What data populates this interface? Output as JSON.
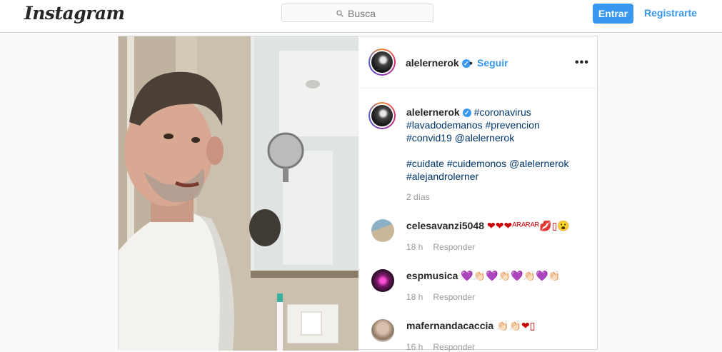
{
  "header": {
    "logo": "Instagram",
    "search_placeholder": "Busca",
    "login_label": "Entrar",
    "register_label": "Registrarte"
  },
  "post": {
    "author": "alelernerok",
    "separator": "•",
    "follow_label": "Seguir",
    "more_label": "•••",
    "caption": {
      "username": "alelernerok",
      "line1": "#coronavirus",
      "line2": "#lavadodemanos #prevencion",
      "line3": "#convid19 @alelernerok",
      "line4": "#cuidate #cuidemonos @alelernerok",
      "line5": "#alejandrolerner"
    },
    "age": "2 días"
  },
  "comments": [
    {
      "username": "celesavanzi5048",
      "text": "❤❤❤ᴬᴿᴬᴿᴬᴿ💋▯😮",
      "time": "18 h",
      "reply_label": "Responder"
    },
    {
      "username": "espmusica",
      "text": "💜👏🏻💜👏🏻💜👏🏻💜👏🏻",
      "time": "18 h",
      "reply_label": "Responder"
    },
    {
      "username": "mafernandacaccia",
      "text": "👏🏻👏🏻❤▯",
      "time": "16 h",
      "reply_label": "Responder"
    }
  ],
  "colors": {
    "accent": "#3897f0",
    "hashtag": "#003569",
    "border": "#dbdbdb"
  }
}
